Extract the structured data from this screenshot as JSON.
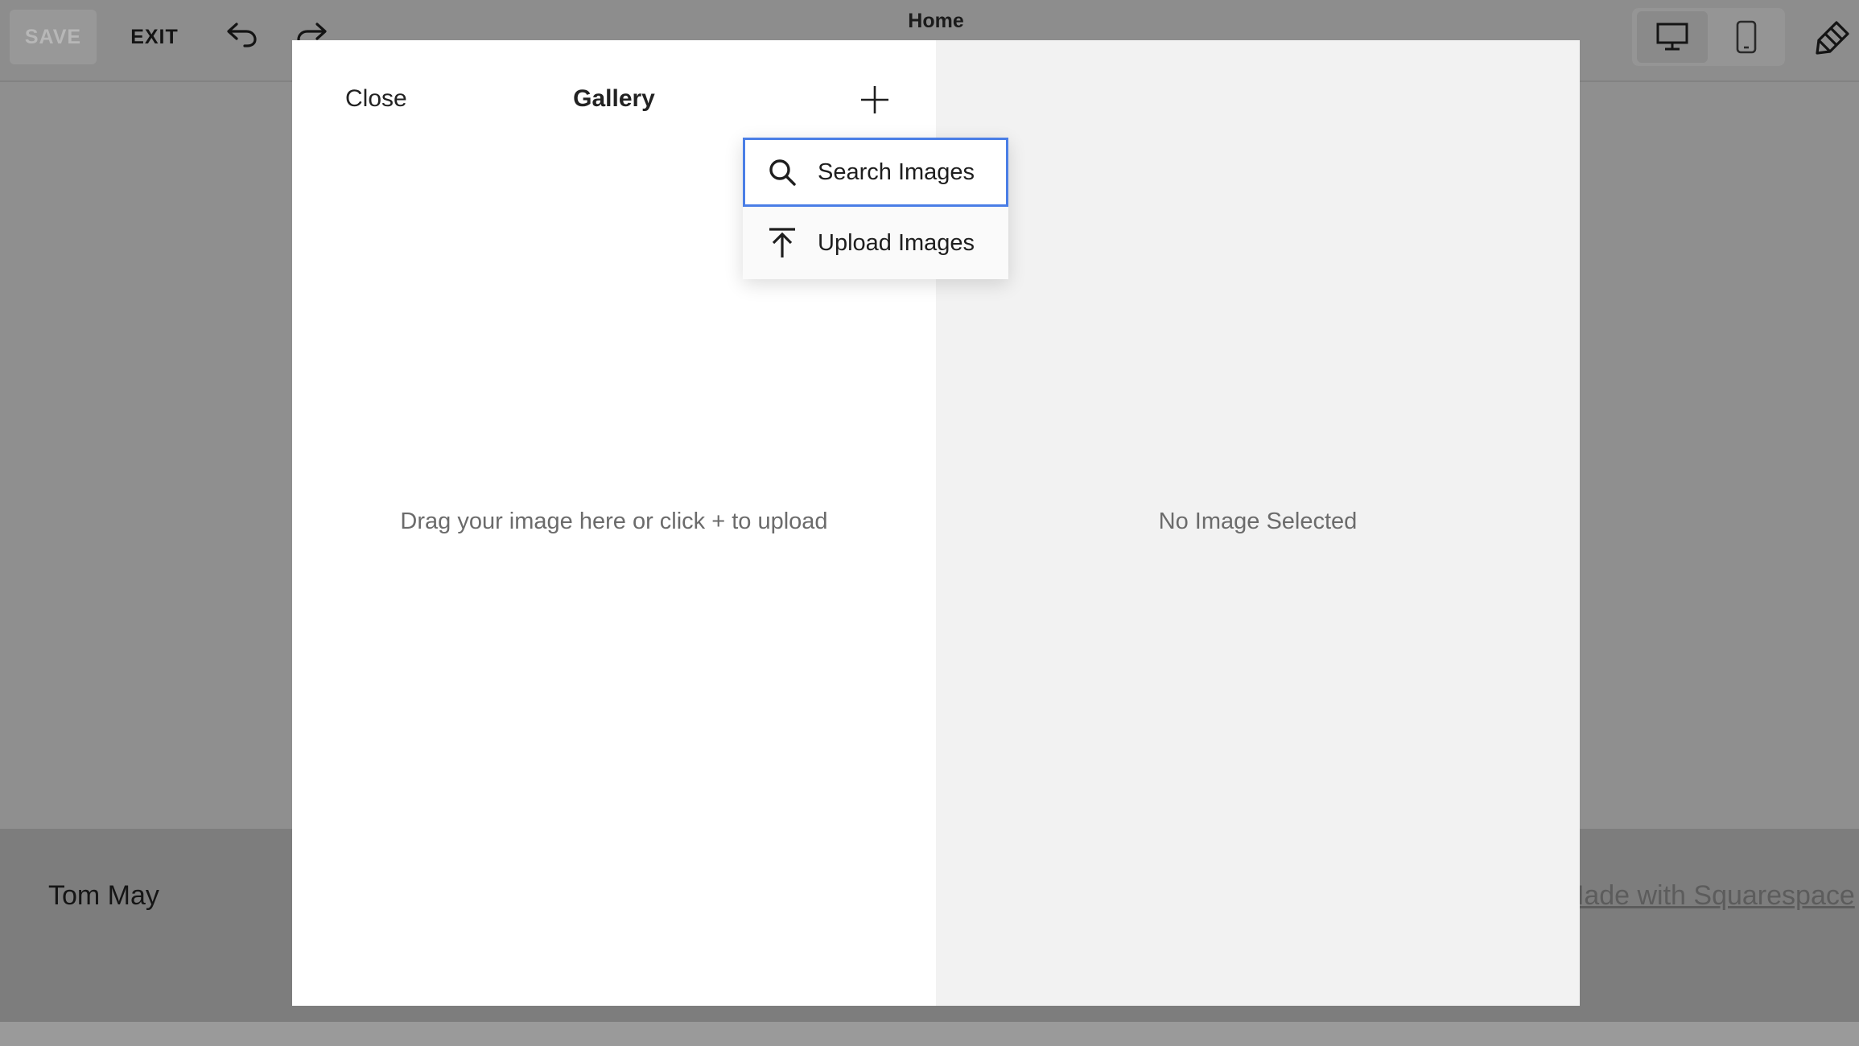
{
  "toolbar": {
    "save_label": "SAVE",
    "exit_label": "EXIT",
    "page_title": "Home"
  },
  "background_page": {
    "site_name": "Tom May",
    "footer_link": "Made with Squarespace"
  },
  "modal": {
    "close_label": "Close",
    "title": "Gallery",
    "drop_hint": "Drag your image here or click + to upload",
    "preview_empty": "No Image Selected"
  },
  "add_menu": {
    "items": [
      {
        "label": "Search Images",
        "icon": "search-icon",
        "focused": true
      },
      {
        "label": "Upload Images",
        "icon": "upload-icon",
        "focused": false
      }
    ]
  },
  "colors": {
    "overlay": "#8f8f8f",
    "modal_left": "#ffffff",
    "modal_right": "#f2f2f2",
    "focus_border": "#4a7ee6"
  }
}
